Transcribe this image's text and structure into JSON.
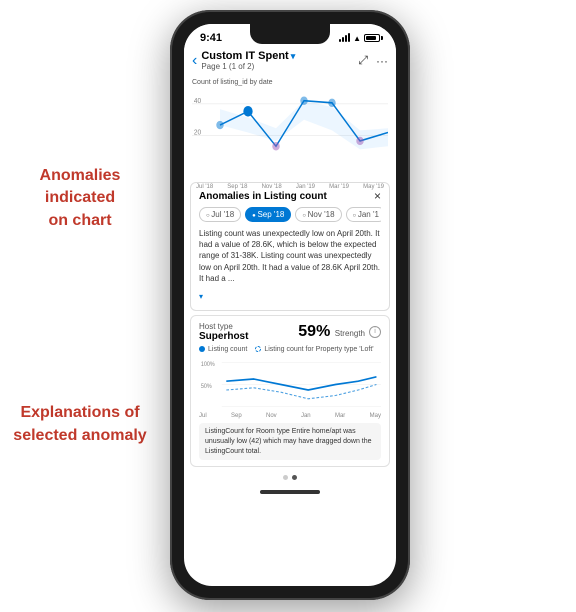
{
  "annotations": {
    "top": "Anomalies indicated\non chart",
    "bottom": "Explanations of\nselected anomaly"
  },
  "status_bar": {
    "time": "9:41",
    "battery_level": "80"
  },
  "header": {
    "back_label": "‹",
    "title": "Custom IT Spent",
    "subtitle": "Page 1 (1 of 2)",
    "expand_icon": "⤢",
    "more_icon": "···"
  },
  "chart": {
    "label": "Count of listing_id by date",
    "y_axis": [
      "40",
      "20"
    ],
    "x_axis": [
      "Jul '18",
      "Sep '18",
      "Nov '18",
      "Jan '19",
      "Mar '19",
      "May '19"
    ]
  },
  "anomaly_panel": {
    "title": "Anomalies in Listing count",
    "close_icon": "×",
    "tabs": [
      {
        "label": "Jul '18",
        "active": false
      },
      {
        "label": "Sep '18",
        "active": true
      },
      {
        "label": "Nov '18",
        "active": false
      },
      {
        "label": "Jan '1",
        "active": false
      }
    ],
    "description": "Listing count was unexpectedly low on April 20th. It had a value of 28.6K, which is below the expected range of 31-38K. Listing count was unexpectedly low on April 20th. It had a value of 28.6K April 20th. It had a ...",
    "see_more": "▾"
  },
  "explanation_card": {
    "type_label": "Host type",
    "name": "Superhost",
    "strength_pct": "59%",
    "strength_label": "Strength",
    "info_icon": "i",
    "legend": [
      {
        "label": "Listing count",
        "color": "#0078d4"
      },
      {
        "label": "Listing count for Property type 'Loft'",
        "color": "#0078d4",
        "dashed": true
      }
    ],
    "y_labels": [
      "100%",
      "50%"
    ],
    "x_labels": [
      "Jul",
      "Sep",
      "Nov",
      "Jan",
      "Mar",
      "May"
    ],
    "footer_text": "ListingCount for Room type Entire home/apt was unusually low (42) which may have dragged down the ListingCount total."
  },
  "pagination": {
    "dots": [
      false,
      true
    ]
  }
}
